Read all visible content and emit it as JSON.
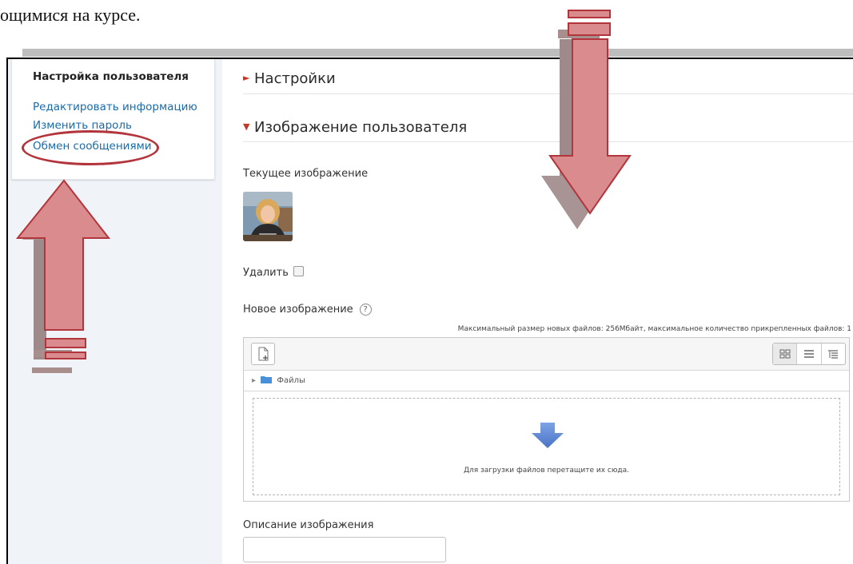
{
  "document_text": "ощимися на курсе.",
  "sidebar": {
    "title": "Настройка пользователя",
    "links": [
      "Редактировать информацию",
      "Изменить пароль",
      "Обмен сообщениями"
    ]
  },
  "sections": [
    {
      "title": "Настройки",
      "expanded": false
    },
    {
      "title": "Изображение пользователя",
      "expanded": true
    }
  ],
  "form": {
    "current_image_label": "Текущее изображение",
    "delete_label": "Удалить",
    "new_image_label": "Новое изображение",
    "max_files_info": "Максимальный размер новых файлов: 256Мбайт, максимальное количество прикрепленных файлов: 1",
    "folder_label": "Файлы",
    "drop_text": "Для загрузки файлов перетащите их сюда.",
    "description_label": "Описание изображения",
    "description_value": ""
  },
  "colors": {
    "link": "#1a6aa8",
    "annotation_red": "#b3353c",
    "arrow_fill": "#d98b8e",
    "sidebar_bg": "#f0f3f7",
    "drop_arrow": "#5b86d6"
  },
  "icons": [
    "add-file-icon",
    "icons-view-icon",
    "list-view-icon",
    "tree-view-icon",
    "folder-icon",
    "help-icon",
    "download-arrow-icon"
  ]
}
